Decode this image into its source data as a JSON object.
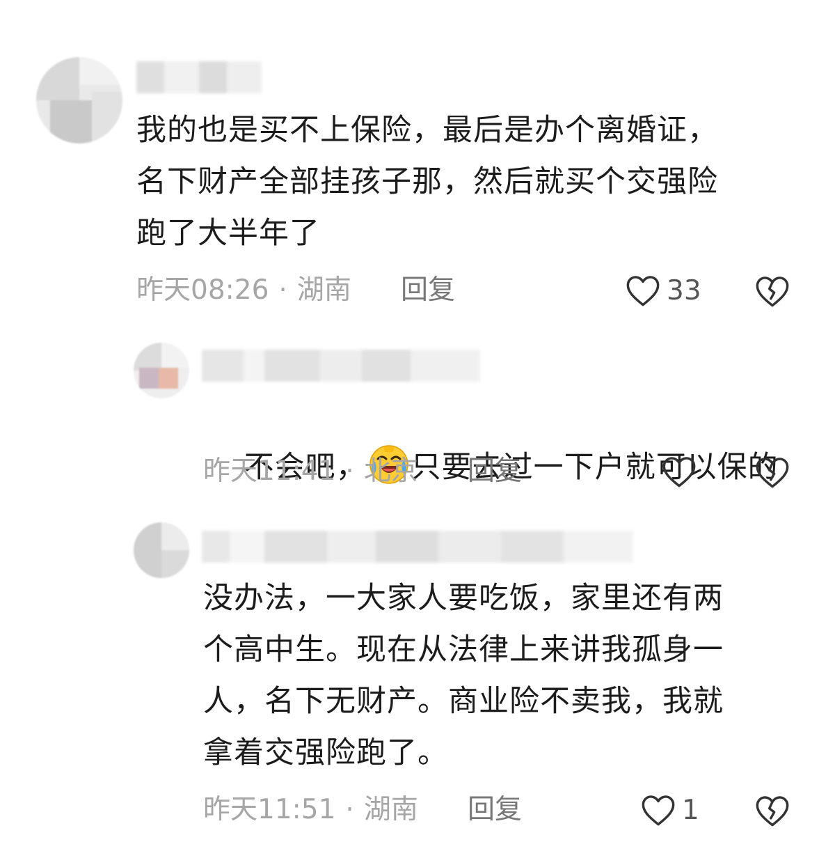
{
  "comments": [
    {
      "text": "我的也是买不上保险，最后是办个离婚证，\n名下财产全部挂孩子那，然后就买个交强险\n跑了大半年了",
      "time": "昨天08:26",
      "separator": "·",
      "location": "湖南",
      "reply_label": "回复",
      "like_count": "33"
    },
    {
      "text_before": "不会吧，",
      "emoji": "laughing-crying-emoji",
      "text_after": "只要去过一下户就可以保的",
      "time": "昨天11:41",
      "separator": "·",
      "location": "北京",
      "reply_label": "回复",
      "like_count": ""
    },
    {
      "text": "没办法，一大家人要吃饭，家里还有两\n个高中生。现在从法律上来讲我孤身一\n人，名下无财产。商业险不卖我，我就\n拿着交强险跑了。",
      "time": "昨天11:51",
      "separator": "·",
      "location": "湖南",
      "reply_label": "回复",
      "like_count": "1"
    }
  ],
  "icons": {
    "like": "heart-outline-icon",
    "dislike": "broken-heart-icon"
  },
  "colors": {
    "text": "#1c1c1c",
    "meta": "#a6a6a6",
    "icon": "#333333"
  }
}
